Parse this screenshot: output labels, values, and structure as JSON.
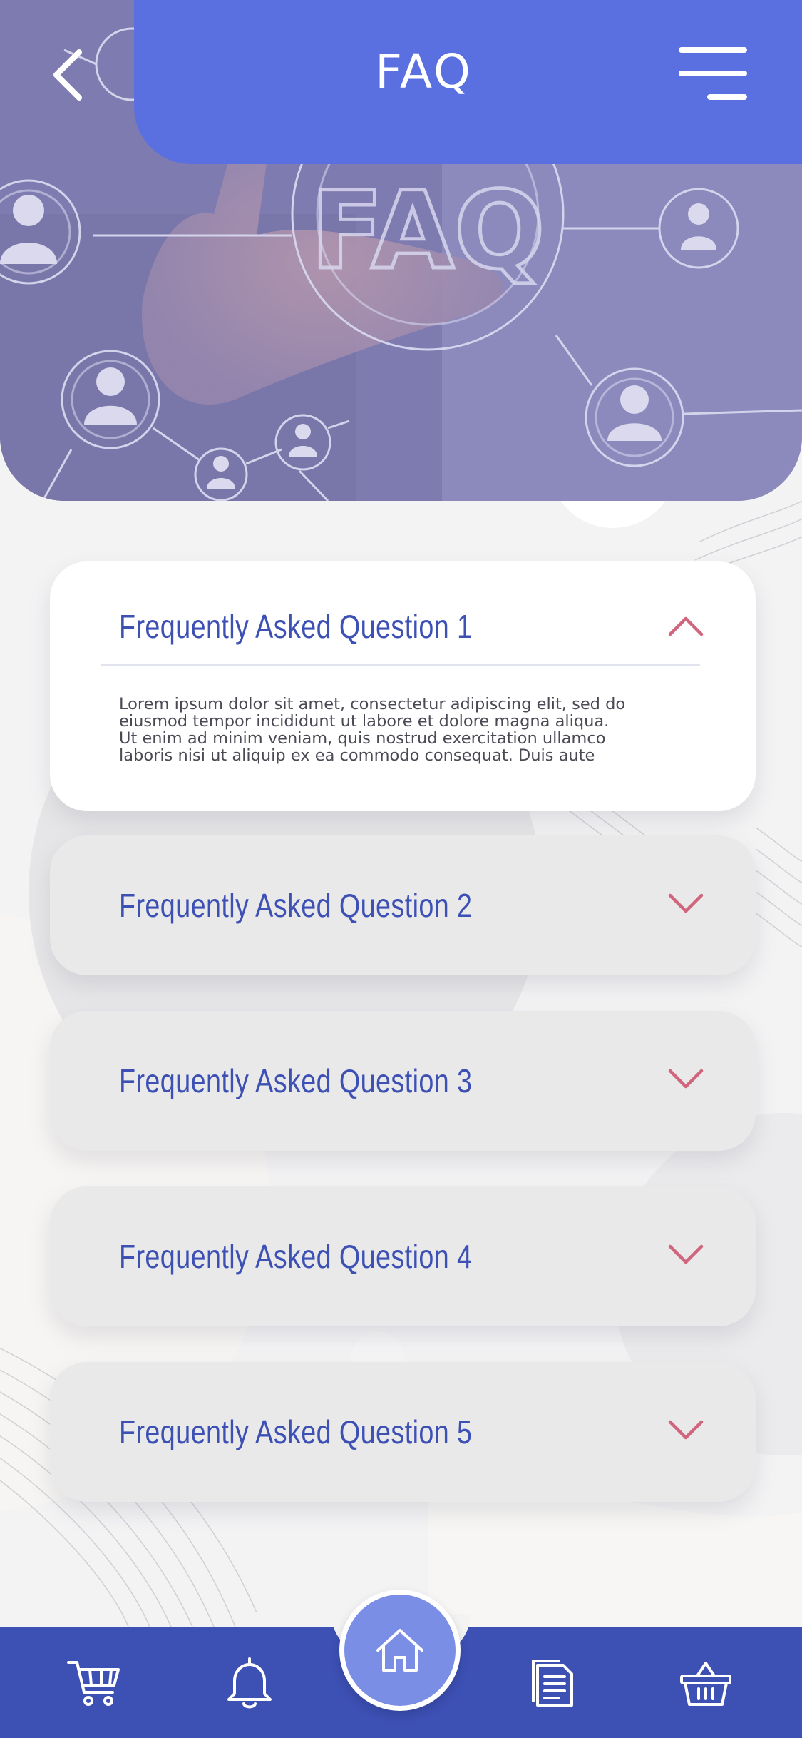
{
  "header": {
    "title": "FAQ",
    "back_icon": "chevron-left-icon",
    "menu_icon": "hamburger-menu-icon",
    "color": "#5a6fe0"
  },
  "hero": {
    "image": "faq-hero-image",
    "overlay_text": "FAQ"
  },
  "faq": {
    "items": [
      {
        "question": "Frequently Asked Question 1",
        "expanded": true,
        "answer_lines": [
          "Lorem ipsum dolor sit amet, consectetur adipiscing elit, sed do",
          "eiusmod tempor incididunt ut labore et dolore magna aliqua.",
          "Ut enim ad minim veniam, quis nostrud exercitation ullamco",
          "laboris nisi ut aliquip ex ea commodo consequat. Duis aute"
        ]
      },
      {
        "question": "Frequently Asked Question 2",
        "expanded": false
      },
      {
        "question": "Frequently Asked Question 3",
        "expanded": false
      },
      {
        "question": "Frequently Asked Question 4",
        "expanded": false
      },
      {
        "question": "Frequently Asked Question 5",
        "expanded": false
      }
    ],
    "question_color": "#3d50b4",
    "chevron_color": "#d0657b"
  },
  "bottom_nav": {
    "color": "#3d50b4",
    "items": [
      {
        "icon": "cart-icon"
      },
      {
        "icon": "bell-icon"
      },
      {
        "icon": "home-icon",
        "active": true
      },
      {
        "icon": "document-icon"
      },
      {
        "icon": "basket-icon"
      }
    ]
  }
}
